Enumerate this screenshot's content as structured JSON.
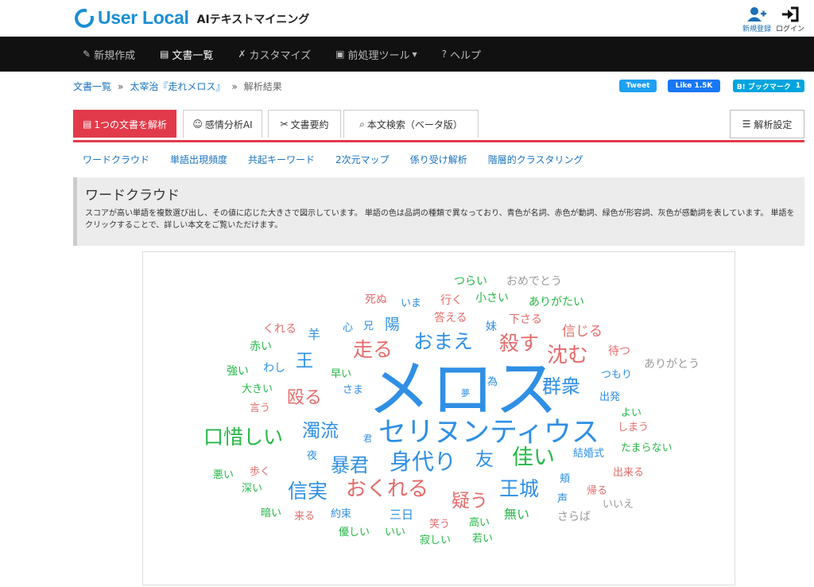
{
  "header": {
    "logo_text": "User Local",
    "logo_sub": "AIテキストマイニング",
    "register_label": "新規登録",
    "login_label": "ログイン"
  },
  "nav": {
    "items": [
      {
        "label": "新規作成",
        "icon": "pencil-icon"
      },
      {
        "label": "文書一覧",
        "icon": "document-icon"
      },
      {
        "label": "カスタマイズ",
        "icon": "wrench-icon"
      },
      {
        "label": "前処理ツール",
        "icon": "toolbox-icon"
      },
      {
        "label": "ヘルプ",
        "icon": "help-icon"
      }
    ]
  },
  "breadcrumb": {
    "items": [
      "文書一覧",
      "太宰治『走れメロス』",
      "解析結果"
    ],
    "separator": "»"
  },
  "social": {
    "tweet_label": "Tweet",
    "like_label": "Like 1.5K",
    "bookmark_label": "B! ブックマーク",
    "bookmark_count": "1"
  },
  "tabs": {
    "items": [
      "1つの文書を解析",
      "感情分析AI",
      "文書要約",
      "本文検索（ベータ版）"
    ],
    "settings_label": "解析設定"
  },
  "subnav": {
    "items": [
      "ワードクラウド",
      "単語出現頻度",
      "共起キーワード",
      "2次元マップ",
      "係り受け解析",
      "階層的クラスタリング"
    ]
  },
  "info": {
    "title": "ワードクラウド",
    "description": "スコアが高い単語を複数選び出し、その値に応じた大きさで図示しています。 単語の色は品詞の種類で異なっており、青色が名詞、赤色が動詞、緑色が形容詞、灰色が感動詞を表しています。 単語をクリックすることで、詳しい本文をご覧いただけます。"
  },
  "colors": {
    "noun": "#2f8fe5",
    "verb": "#e56b6b",
    "adjective": "#25b847",
    "interjection": "#9a9a9a",
    "accent": "#e23a4a"
  },
  "wordcloud": {
    "words": [
      {
        "text": "メロス",
        "pos": "noun"
      },
      {
        "text": "セリヌンティウス",
        "pos": "noun"
      },
      {
        "text": "身代り",
        "pos": "noun"
      },
      {
        "text": "暴君",
        "pos": "noun"
      },
      {
        "text": "信実",
        "pos": "noun"
      },
      {
        "text": "王城",
        "pos": "noun"
      },
      {
        "text": "群衆",
        "pos": "noun"
      },
      {
        "text": "おまえ",
        "pos": "noun"
      },
      {
        "text": "濁流",
        "pos": "noun"
      },
      {
        "text": "友",
        "pos": "noun"
      },
      {
        "text": "王",
        "pos": "noun"
      },
      {
        "text": "陽",
        "pos": "noun"
      },
      {
        "text": "羊",
        "pos": "noun"
      },
      {
        "text": "三日",
        "pos": "noun"
      },
      {
        "text": "わし",
        "pos": "noun"
      },
      {
        "text": "いま",
        "pos": "noun"
      },
      {
        "text": "兄",
        "pos": "noun"
      },
      {
        "text": "心",
        "pos": "noun"
      },
      {
        "text": "妹",
        "pos": "noun"
      },
      {
        "text": "つもり",
        "pos": "noun"
      },
      {
        "text": "出発",
        "pos": "noun"
      },
      {
        "text": "結婚式",
        "pos": "noun"
      },
      {
        "text": "さま",
        "pos": "noun"
      },
      {
        "text": "為",
        "pos": "noun"
      },
      {
        "text": "夢",
        "pos": "noun"
      },
      {
        "text": "君",
        "pos": "noun"
      },
      {
        "text": "夜",
        "pos": "noun"
      },
      {
        "text": "約束",
        "pos": "noun"
      },
      {
        "text": "声",
        "pos": "noun"
      },
      {
        "text": "頬",
        "pos": "noun"
      },
      {
        "text": "殺す",
        "pos": "verb"
      },
      {
        "text": "走る",
        "pos": "verb"
      },
      {
        "text": "沈む",
        "pos": "verb"
      },
      {
        "text": "殴る",
        "pos": "verb"
      },
      {
        "text": "おくれる",
        "pos": "verb"
      },
      {
        "text": "疑う",
        "pos": "verb"
      },
      {
        "text": "信じる",
        "pos": "verb"
      },
      {
        "text": "死ぬ",
        "pos": "verb"
      },
      {
        "text": "くれる",
        "pos": "verb"
      },
      {
        "text": "答える",
        "pos": "verb"
      },
      {
        "text": "行く",
        "pos": "verb"
      },
      {
        "text": "下さる",
        "pos": "verb"
      },
      {
        "text": "待つ",
        "pos": "verb"
      },
      {
        "text": "言う",
        "pos": "verb"
      },
      {
        "text": "歩く",
        "pos": "verb"
      },
      {
        "text": "来る",
        "pos": "verb"
      },
      {
        "text": "笑う",
        "pos": "verb"
      },
      {
        "text": "しまう",
        "pos": "verb"
      },
      {
        "text": "出来る",
        "pos": "verb"
      },
      {
        "text": "帰る",
        "pos": "verb"
      },
      {
        "text": "口惜しい",
        "pos": "adjective"
      },
      {
        "text": "佳い",
        "pos": "adjective"
      },
      {
        "text": "無い",
        "pos": "adjective"
      },
      {
        "text": "つらい",
        "pos": "adjective"
      },
      {
        "text": "小さい",
        "pos": "adjective"
      },
      {
        "text": "ありがたい",
        "pos": "adjective"
      },
      {
        "text": "赤い",
        "pos": "adjective"
      },
      {
        "text": "強い",
        "pos": "adjective"
      },
      {
        "text": "早い",
        "pos": "adjective"
      },
      {
        "text": "大きい",
        "pos": "adjective"
      },
      {
        "text": "よい",
        "pos": "adjective"
      },
      {
        "text": "たまらない",
        "pos": "adjective"
      },
      {
        "text": "悪い",
        "pos": "adjective"
      },
      {
        "text": "深い",
        "pos": "adjective"
      },
      {
        "text": "暗い",
        "pos": "adjective"
      },
      {
        "text": "優しい",
        "pos": "adjective"
      },
      {
        "text": "いい",
        "pos": "adjective"
      },
      {
        "text": "高い",
        "pos": "adjective"
      },
      {
        "text": "寂しい",
        "pos": "adjective"
      },
      {
        "text": "若い",
        "pos": "adjective"
      },
      {
        "text": "おめでとう",
        "pos": "interjection"
      },
      {
        "text": "ありがとう",
        "pos": "interjection"
      },
      {
        "text": "いいえ",
        "pos": "interjection"
      },
      {
        "text": "さらば",
        "pos": "interjection"
      }
    ]
  }
}
